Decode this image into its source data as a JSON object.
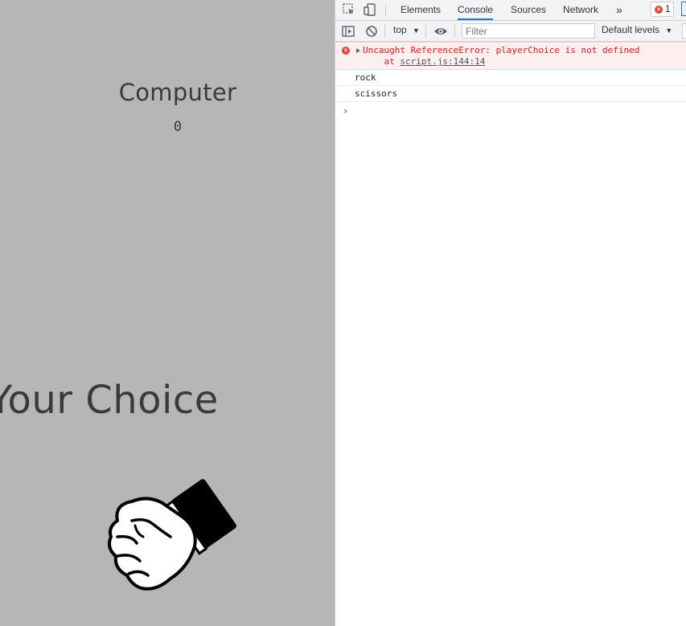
{
  "page": {
    "computer_title": "Computer",
    "computer_score": "0",
    "your_choice_heading": "Your Choice"
  },
  "devtools": {
    "tabs": [
      {
        "label": "Elements"
      },
      {
        "label": "Console",
        "active": true
      },
      {
        "label": "Sources"
      },
      {
        "label": "Network"
      }
    ],
    "more_tabs": "»",
    "error_count": "1",
    "toolbar": {
      "context": "top",
      "filter_placeholder": "Filter",
      "levels": "Default levels"
    },
    "console": {
      "error_line1": "Uncaught ReferenceError: playerChoice is not defined",
      "error_at_prefix": "    at ",
      "error_link": "script.js:144:14",
      "logs": [
        "rock",
        "scissors"
      ],
      "prompt": "›"
    }
  },
  "colors": {
    "page_bg": "#b6b6b7",
    "text_dark": "#3a3a3a",
    "error_red": "#e01b1b",
    "accent_blue": "#1a73e8"
  }
}
